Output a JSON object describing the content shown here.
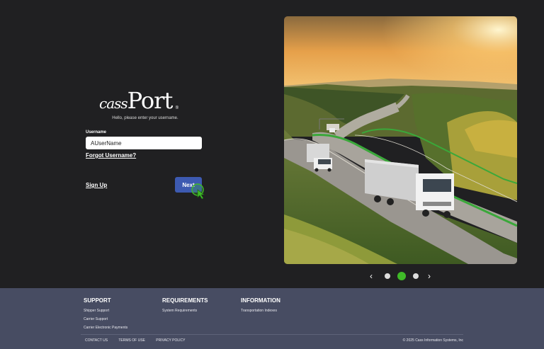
{
  "brand": {
    "logo_main": "Port",
    "logo_prefix": "cass",
    "logo_reg": "®",
    "tagline": "Hello, please enter your username."
  },
  "login": {
    "username_label": "Username",
    "username_value": "AUserName",
    "forgot_label": "Forgot Username?",
    "signup_label": "Sign Up",
    "next_label": "Next"
  },
  "carousel": {
    "prev_label": "‹",
    "next_label": "›",
    "active_index": 2,
    "total": 3
  },
  "footer": {
    "support": {
      "heading": "SUPPORT",
      "links": [
        "Shipper Support",
        "Carrier Support",
        "Carrier Electronic Payments"
      ]
    },
    "requirements": {
      "heading": "REQUIREMENTS",
      "links": [
        "System Requirements"
      ]
    },
    "information": {
      "heading": "INFORMATION",
      "links": [
        "Transportation Indexes"
      ]
    },
    "bottom_links": [
      "CONTACT US",
      "TERMS OF USE",
      "PRIVACY POLICY"
    ],
    "copyright": "© 2025 Cass Information Systems, Inc"
  },
  "colors": {
    "background": "#202022",
    "footer": "#474c62",
    "button": "#3d5ab1",
    "active_dot": "#3fb928"
  }
}
